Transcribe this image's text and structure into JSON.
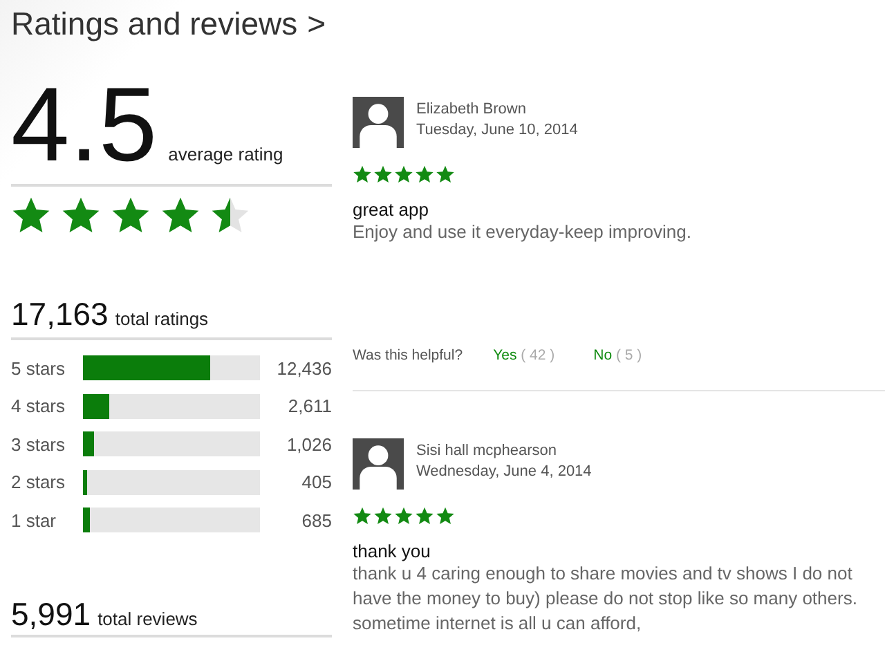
{
  "header": {
    "title": "Ratings and reviews",
    "chevron": ">"
  },
  "summary": {
    "average": "4.5",
    "average_label": "average rating",
    "stars": 4.5,
    "total_ratings": "17,163",
    "total_ratings_label": "total ratings",
    "breakdown": [
      {
        "label": "5 stars",
        "level": 0.72,
        "count": "12,436"
      },
      {
        "label": "4 stars",
        "level": 0.15,
        "count": "2,611"
      },
      {
        "label": "3 stars",
        "level": 0.06,
        "count": "1,026"
      },
      {
        "label": "2 stars",
        "level": 0.02,
        "count": "405"
      },
      {
        "label": "1 star",
        "level": 0.04,
        "count": "685"
      }
    ],
    "total_reviews": "5,991",
    "total_reviews_label": "total reviews"
  },
  "reviews": [
    {
      "author": "Elizabeth Brown",
      "date": "Tuesday, June 10, 2014",
      "stars": 5,
      "title": "great app",
      "body": "Enjoy and use it everyday-keep improving.",
      "helpful_prompt": "Was this helpful?",
      "yes": "Yes",
      "yes_count": "( 42 )",
      "no": "No",
      "no_count": "( 5 )"
    },
    {
      "author": "Sisi hall mcphearson",
      "date": "Wednesday, June 4, 2014",
      "stars": 5,
      "title": "thank you",
      "body": "thank u 4 caring enough to share movies and tv shows I do not have the money to buy) please do not stop like so many others. sometime internet is all u can afford,"
    }
  ]
}
